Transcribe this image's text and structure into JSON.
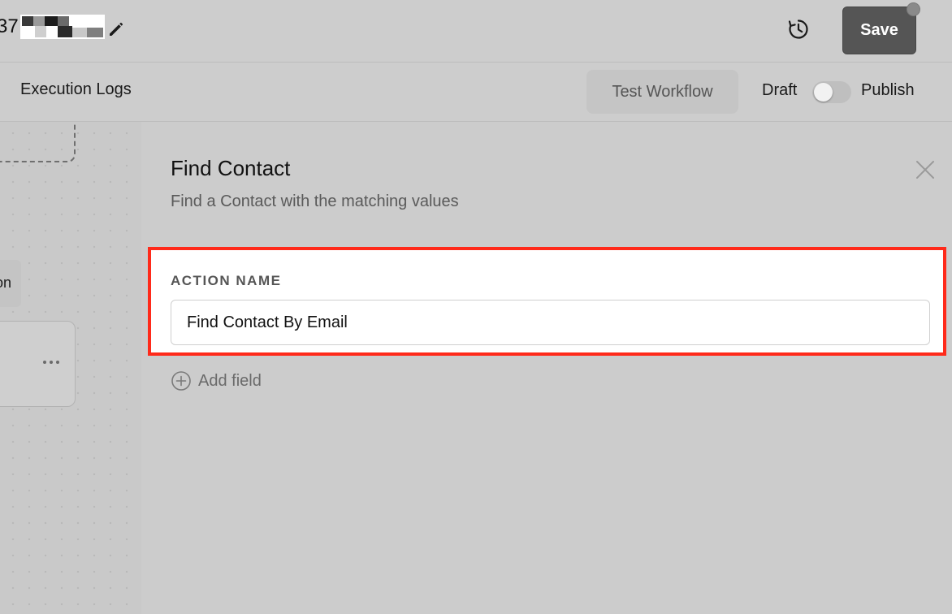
{
  "header": {
    "workflow_name_visible": "37",
    "save_label": "Save",
    "icons": {
      "edit": "pencil-icon",
      "history": "history-clock-icon"
    }
  },
  "subheader": {
    "tab_label": "Execution Logs",
    "test_button_label": "Test Workflow",
    "draft_label": "Draft",
    "publish_label": "Publish",
    "publish_toggle_on": false
  },
  "canvas": {
    "partial_node_label": "on",
    "more_icon": "more-horizontal-icon"
  },
  "panel": {
    "title": "Find Contact",
    "subtitle": "Find a Contact with the matching values",
    "field": {
      "label": "ACTION NAME",
      "value": "Find Contact By Email"
    },
    "add_field_label": "Add field",
    "highlight_color": "#ff2a1a"
  },
  "colors": {
    "save_button": "#555555",
    "background": "#cbcbcb"
  }
}
